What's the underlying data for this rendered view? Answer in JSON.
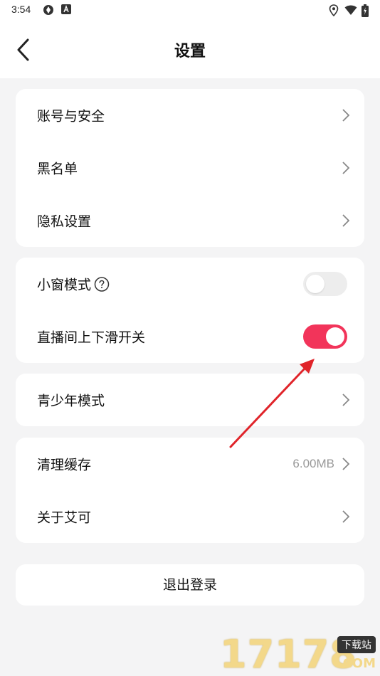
{
  "status_bar": {
    "time": "3:54"
  },
  "header": {
    "title": "设置"
  },
  "group1": [
    {
      "label": "账号与安全"
    },
    {
      "label": "黑名单"
    },
    {
      "label": "隐私设置"
    }
  ],
  "group2": {
    "mini_window": {
      "label": "小窗模式",
      "enabled": false
    },
    "live_swipe": {
      "label": "直播间上下滑开关",
      "enabled": true
    }
  },
  "group3": {
    "teen_mode": {
      "label": "青少年模式"
    }
  },
  "group4": {
    "clear_cache": {
      "label": "清理缓存",
      "value": "6.00MB"
    },
    "about": {
      "label": "关于艾可"
    }
  },
  "logout": {
    "label": "退出登录"
  },
  "watermark": {
    "digits": "17178",
    "tag": "下载站",
    "suffix": ".COM"
  },
  "colors": {
    "accent": "#f2345a",
    "annotation_arrow": "#e0242a",
    "background": "#f4f4f5"
  }
}
